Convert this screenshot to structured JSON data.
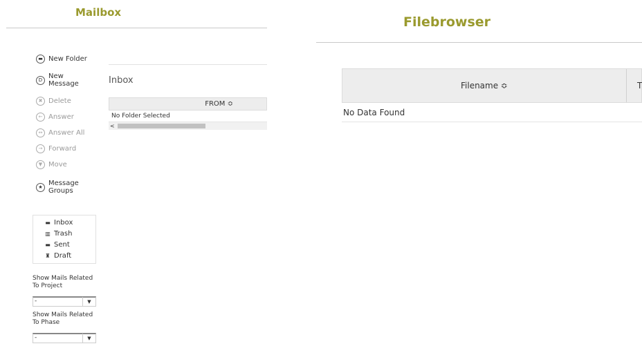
{
  "mailbox": {
    "title": "Mailbox",
    "actions": {
      "new_folder": "New Folder",
      "new_message_1": "New",
      "new_message_2": "Message",
      "delete": "Delete",
      "answer": "Answer",
      "answer_all": "Answer All",
      "forward": "Forward",
      "move": "Move",
      "message_groups_1": "Message",
      "message_groups_2": "Groups"
    },
    "folders": [
      "Inbox",
      "Trash",
      "Sent",
      "Draft"
    ],
    "filters": {
      "project_label_1": "Show Mails Related",
      "project_label_2": "To Project",
      "project_value": "-",
      "phase_label_1": "Show Mails Related",
      "phase_label_2": "To Phase",
      "phase_value": "-"
    },
    "inbox": {
      "heading": "Inbox",
      "column_from": "FROM ≎",
      "empty_text": "No Folder Selected"
    }
  },
  "filebrowser": {
    "title": "Filebrowser",
    "column_filename": "Filename ≎",
    "column_second": "T",
    "empty_text": "No Data Found"
  },
  "icons": {
    "new_folder": "folder-icon",
    "new_message": "message-icon",
    "delete": "x-icon",
    "answer": "reply-icon",
    "answer_all": "reply-all-icon",
    "forward": "forward-icon",
    "move": "chevron-down-icon",
    "message_groups": "star-icon"
  },
  "colors": {
    "title": "#9a9a2e",
    "header_bg": "#ededed"
  }
}
